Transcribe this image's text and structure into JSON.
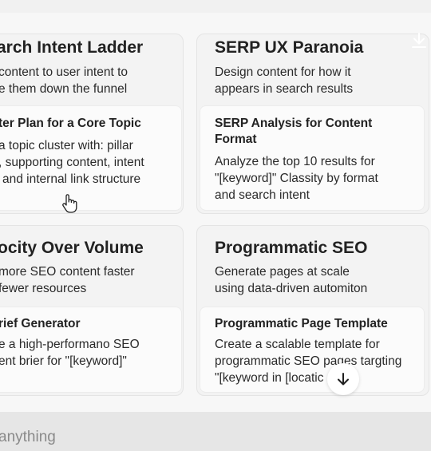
{
  "cards": [
    {
      "title": "arch Intent Ladder",
      "desc": [
        "content to user intent to",
        "e them down the funnel"
      ],
      "prompt_title": [
        "ter Plan for a Core Topic"
      ],
      "prompt_desc": [
        "a topic cluster with: pillar",
        ", supporting content, intent",
        "and internal link structure"
      ]
    },
    {
      "title": "SERP UX Paranoia",
      "desc": [
        "Design content for how it",
        "appears in search results"
      ],
      "prompt_title": [
        "SERP Analysis for Content",
        "Format"
      ],
      "prompt_desc": [
        "Analyze the top 10 results for",
        "\"[keyword]\" Classity by format",
        "and search intent"
      ]
    },
    {
      "title": "ocity Over Volume",
      "desc": [
        "more SEO content faster",
        "fewer resources"
      ],
      "prompt_title": [
        "rief Generator"
      ],
      "prompt_desc": [
        "e a high-performano SEO",
        "ent brier for \"[keyword]\""
      ]
    },
    {
      "title": "Programmatic SEO",
      "desc": [
        "Generate pages at scale",
        "using data-driven automiton"
      ],
      "prompt_title": [
        "Programmatic Page Template"
      ],
      "prompt_desc": [
        "Create a scalable template for",
        "programmatic SEO paqes targting",
        "\"[keyword in [locatic"
      ]
    }
  ],
  "input": {
    "placeholder": "anything"
  },
  "icons": {
    "download": "download-icon",
    "scroll": "arrow-down-icon",
    "cursor": "hand-pointer-icon"
  }
}
